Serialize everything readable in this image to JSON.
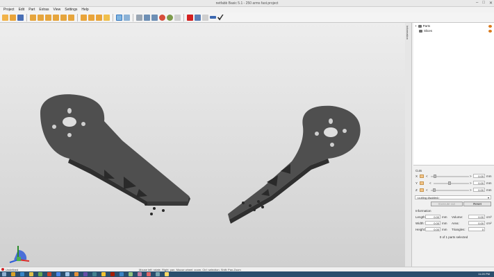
{
  "window": {
    "title": "netfabb Basic 5.1 - 250 arms fast.project"
  },
  "menu": [
    "Project",
    "Edit",
    "Part",
    "Extras",
    "View",
    "Settings",
    "Help"
  ],
  "tree": {
    "items": [
      {
        "label": "Parts"
      },
      {
        "label": "Slices"
      }
    ]
  },
  "vertical_tab": "Information",
  "cuts": {
    "title": "Cuts",
    "axes": [
      {
        "axis": "X",
        "op": "<",
        "gt": ">",
        "value": "0.00",
        "unit": "mm"
      },
      {
        "axis": "Y",
        "op": "<",
        "gt": ">",
        "value": "0.00",
        "unit": "mm"
      },
      {
        "axis": "Z",
        "op": "<",
        "gt": ">",
        "value": "0.00",
        "unit": "mm"
      }
    ],
    "mode_select": "<cutting disabled>",
    "execute_label": "Execute cut",
    "reset_label": "Reset"
  },
  "info": {
    "title": "Information",
    "length_label": "Length:",
    "length_value": "0.00",
    "length_unit": "mm",
    "width_label": "Width:",
    "width_value": "0.00",
    "width_unit": "mm",
    "height_label": "Height:",
    "height_value": "0.00",
    "height_unit": "mm",
    "volume_label": "Volume:",
    "volume_value": "0.00",
    "volume_unit": "cm³",
    "area_label": "Area:",
    "area_value": "0.00",
    "area_unit": "cm²",
    "triangles_label": "Triangles:",
    "triangles_value": "0"
  },
  "selection_status": "0 of 1 parts selected",
  "statusbar": {
    "left": "Undefined",
    "hint": "Mouse left: rotate. Right: pan. Mouse wheel: zoom. Ctrl: selection. Shift: Pan-Zoom",
    "right": ""
  },
  "clock": "11:20 PM",
  "colors": {
    "accent": "#d97a1d",
    "model": "#4f4f4f",
    "taskbar": "#2b4e6d"
  }
}
